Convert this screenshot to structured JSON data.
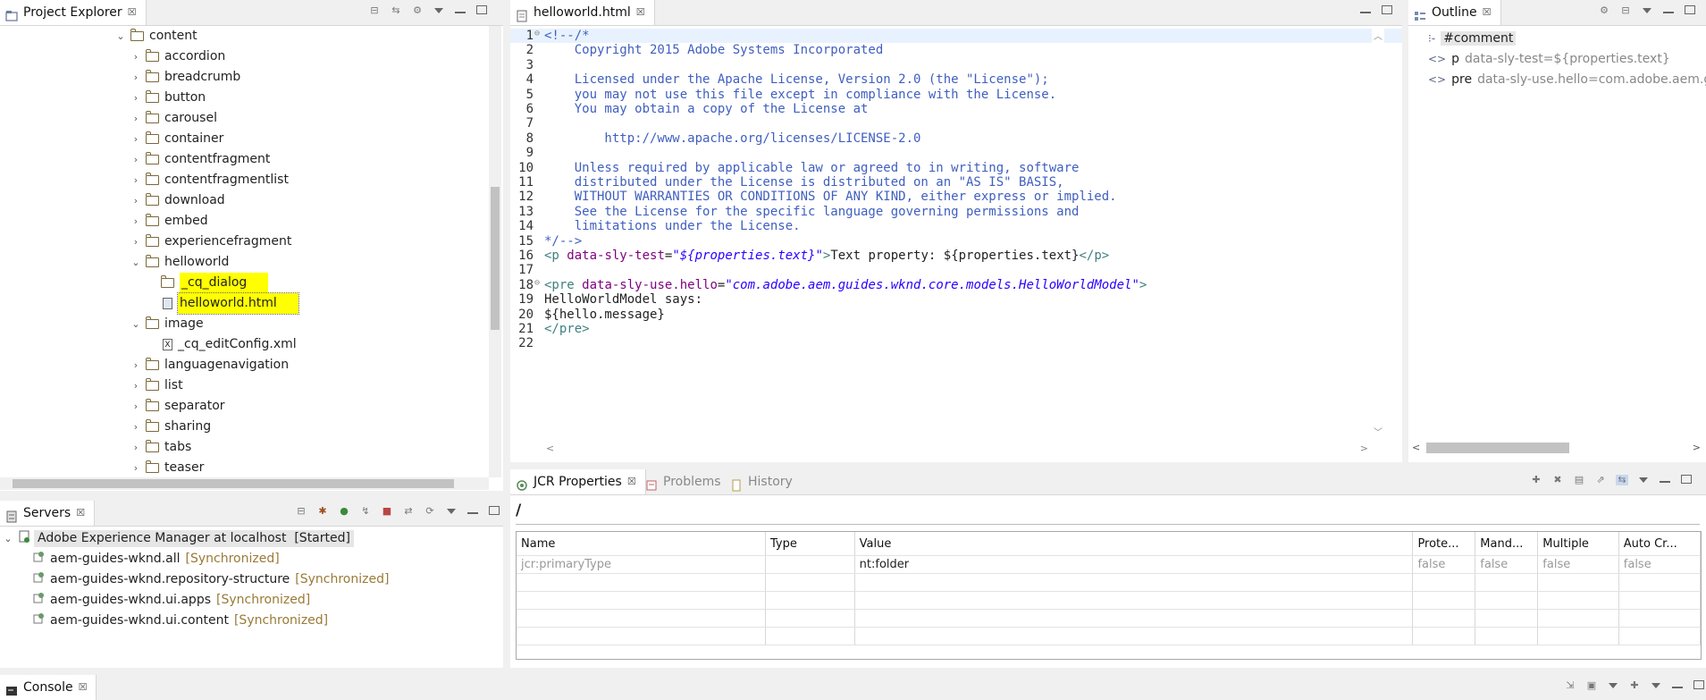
{
  "project_explorer": {
    "tab_label": "Project Explorer",
    "tree": [
      {
        "label": "content",
        "indent": 0,
        "expanded": true,
        "type": "folder"
      },
      {
        "label": "accordion",
        "indent": 1,
        "type": "folder"
      },
      {
        "label": "breadcrumb",
        "indent": 1,
        "type": "folder"
      },
      {
        "label": "button",
        "indent": 1,
        "type": "folder"
      },
      {
        "label": "carousel",
        "indent": 1,
        "type": "folder"
      },
      {
        "label": "container",
        "indent": 1,
        "type": "folder"
      },
      {
        "label": "contentfragment",
        "indent": 1,
        "type": "folder"
      },
      {
        "label": "contentfragmentlist",
        "indent": 1,
        "type": "folder"
      },
      {
        "label": "download",
        "indent": 1,
        "type": "folder"
      },
      {
        "label": "embed",
        "indent": 1,
        "type": "folder"
      },
      {
        "label": "experiencefragment",
        "indent": 1,
        "type": "folder"
      },
      {
        "label": "helloworld",
        "indent": 1,
        "expanded": true,
        "type": "folder"
      },
      {
        "label": "_cq_dialog",
        "indent": 2,
        "type": "folder",
        "highlight": true
      },
      {
        "label": "helloworld.html",
        "indent": 2,
        "type": "file",
        "highlight": true,
        "selected": true
      },
      {
        "label": "image",
        "indent": 1,
        "expanded": true,
        "type": "folder"
      },
      {
        "label": "_cq_editConfig.xml",
        "indent": 2,
        "type": "xml"
      },
      {
        "label": "languagenavigation",
        "indent": 1,
        "type": "folder"
      },
      {
        "label": "list",
        "indent": 1,
        "type": "folder"
      },
      {
        "label": "separator",
        "indent": 1,
        "type": "folder"
      },
      {
        "label": "sharing",
        "indent": 1,
        "type": "folder"
      },
      {
        "label": "tabs",
        "indent": 1,
        "type": "folder"
      },
      {
        "label": "teaser",
        "indent": 1,
        "type": "folder"
      }
    ]
  },
  "editor": {
    "tab_label": "helloworld.html",
    "lines": [
      {
        "n": "1",
        "fold": true,
        "parts": [
          {
            "c": "cm",
            "t": "<!--/*"
          }
        ]
      },
      {
        "n": "2",
        "parts": [
          {
            "c": "cm",
            "t": "    Copyright 2015 Adobe Systems Incorporated"
          }
        ]
      },
      {
        "n": "3",
        "parts": []
      },
      {
        "n": "4",
        "parts": [
          {
            "c": "cm",
            "t": "    Licensed under the Apache License, Version 2.0 (the \"License\");"
          }
        ]
      },
      {
        "n": "5",
        "parts": [
          {
            "c": "cm",
            "t": "    you may not use this file except in compliance with the License."
          }
        ]
      },
      {
        "n": "6",
        "parts": [
          {
            "c": "cm",
            "t": "    You may obtain a copy of the License at"
          }
        ]
      },
      {
        "n": "7",
        "parts": []
      },
      {
        "n": "8",
        "parts": [
          {
            "c": "cm",
            "t": "        http://www.apache.org/licenses/LICENSE-2.0"
          }
        ]
      },
      {
        "n": "9",
        "parts": []
      },
      {
        "n": "10",
        "parts": [
          {
            "c": "cm",
            "t": "    Unless required by applicable law or agreed to in writing, software"
          }
        ]
      },
      {
        "n": "11",
        "parts": [
          {
            "c": "cm",
            "t": "    distributed under the License is distributed on an \"AS IS\" BASIS,"
          }
        ]
      },
      {
        "n": "12",
        "parts": [
          {
            "c": "cm",
            "t": "    WITHOUT WARRANTIES OR CONDITIONS OF ANY KIND, either express or implied."
          }
        ]
      },
      {
        "n": "13",
        "parts": [
          {
            "c": "cm",
            "t": "    See the License for the specific language governing permissions and"
          }
        ]
      },
      {
        "n": "14",
        "parts": [
          {
            "c": "cm",
            "t": "    limitations under the License."
          }
        ]
      },
      {
        "n": "15",
        "parts": [
          {
            "c": "cm",
            "t": "*/-->"
          }
        ]
      },
      {
        "n": "16",
        "parts": [
          {
            "c": "tg",
            "t": "<p "
          },
          {
            "c": "at",
            "t": "data-sly-test"
          },
          {
            "c": "",
            "t": "="
          },
          {
            "c": "av",
            "t": "\"${properties.text}\""
          },
          {
            "c": "tg",
            "t": ">"
          },
          {
            "c": "",
            "t": "Text property: ${properties.text}"
          },
          {
            "c": "tg",
            "t": "</p>"
          }
        ]
      },
      {
        "n": "17",
        "parts": []
      },
      {
        "n": "18",
        "fold": true,
        "parts": [
          {
            "c": "tg",
            "t": "<pre "
          },
          {
            "c": "at",
            "t": "data-sly-use.hello"
          },
          {
            "c": "",
            "t": "="
          },
          {
            "c": "av",
            "t": "\"com.adobe.aem.guides.wknd.core.models.HelloWorldModel\""
          },
          {
            "c": "tg",
            "t": ">"
          }
        ]
      },
      {
        "n": "19",
        "parts": [
          {
            "c": "",
            "t": "HelloWorldModel says:"
          }
        ]
      },
      {
        "n": "20",
        "parts": [
          {
            "c": "",
            "t": "${hello.message}"
          }
        ]
      },
      {
        "n": "21",
        "parts": [
          {
            "c": "tg",
            "t": "</pre>"
          }
        ]
      },
      {
        "n": "22",
        "parts": []
      }
    ]
  },
  "outline": {
    "tab_label": "Outline",
    "items": [
      {
        "tag": "#comment",
        "detail": "",
        "selected": true
      },
      {
        "tag": "p",
        "detail": "data-sly-test=${properties.text}"
      },
      {
        "tag": "pre",
        "detail": "data-sly-use.hello=com.adobe.aem.gui"
      }
    ]
  },
  "servers": {
    "tab_label": "Servers",
    "server": {
      "name": "Adobe Experience Manager at localhost",
      "state": "[Started]"
    },
    "modules": [
      {
        "name": "aem-guides-wknd.all",
        "status": "[Synchronized]"
      },
      {
        "name": "aem-guides-wknd.repository-structure",
        "status": "[Synchronized]"
      },
      {
        "name": "aem-guides-wknd.ui.apps",
        "status": "[Synchronized]"
      },
      {
        "name": "aem-guides-wknd.ui.content",
        "status": "[Synchronized]"
      }
    ]
  },
  "jcr": {
    "tabs": {
      "jcr": "JCR Properties",
      "problems": "Problems",
      "history": "History"
    },
    "path": "/",
    "columns": [
      "Name",
      "Type",
      "Value",
      "Prote...",
      "Mand...",
      "Multiple",
      "Auto Cr..."
    ],
    "rows": [
      [
        "jcr:primaryType",
        "",
        "nt:folder",
        "false",
        "false",
        "false",
        "false"
      ],
      [
        "",
        "",
        "",
        "",
        "",
        "",
        ""
      ],
      [
        "",
        "",
        "",
        "",
        "",
        "",
        ""
      ],
      [
        "",
        "",
        "",
        "",
        "",
        "",
        ""
      ],
      [
        "",
        "",
        "",
        "",
        "",
        "",
        ""
      ]
    ]
  },
  "console": {
    "tab_label": "Console"
  },
  "colors": {
    "highlight": "#ffff00",
    "comment": "#3f5fbf",
    "tag": "#3f7f7f",
    "attr": "#7f007f",
    "attr_value": "#2a00ff",
    "sync": "#9a7a36"
  }
}
